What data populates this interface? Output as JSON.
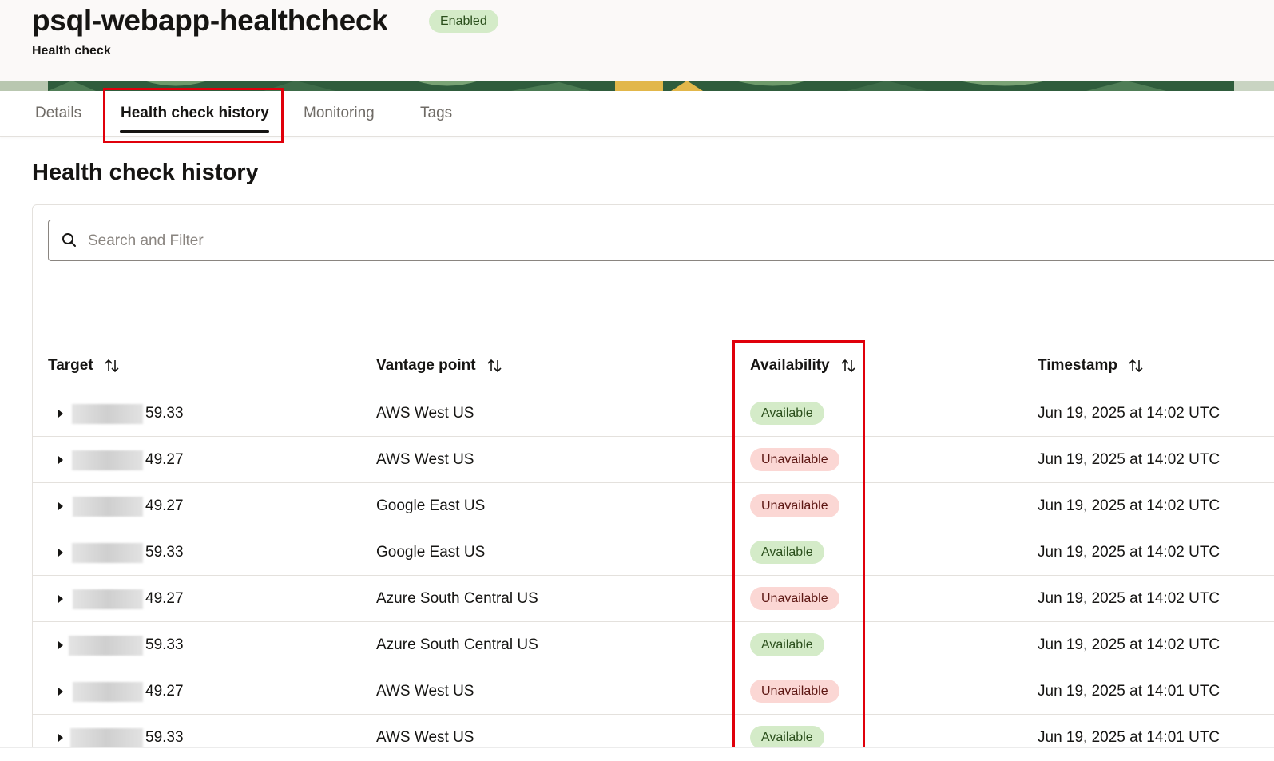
{
  "header": {
    "title": "psql-webapp-healthcheck",
    "status": "Enabled",
    "subtitle": "Health check"
  },
  "tabs": [
    {
      "label": "Details",
      "active": false
    },
    {
      "label": "Health check history",
      "active": true
    },
    {
      "label": "Monitoring",
      "active": false
    },
    {
      "label": "Tags",
      "active": false
    }
  ],
  "section": {
    "title": "Health check history"
  },
  "search": {
    "placeholder": "Search and Filter"
  },
  "table": {
    "columns": [
      "Target",
      "Vantage point",
      "Availability",
      "Timestamp"
    ],
    "rows": [
      {
        "target": "59.33",
        "vantage": "AWS West US",
        "availability": "Available",
        "timestamp": "Jun 19, 2025 at 14:02 UTC"
      },
      {
        "target": "49.27",
        "vantage": "AWS West US",
        "availability": "Unavailable",
        "timestamp": "Jun 19, 2025 at 14:02 UTC"
      },
      {
        "target": "49.27",
        "vantage": "Google East US",
        "availability": "Unavailable",
        "timestamp": "Jun 19, 2025 at 14:02 UTC"
      },
      {
        "target": "59.33",
        "vantage": "Google East US",
        "availability": "Available",
        "timestamp": "Jun 19, 2025 at 14:02 UTC"
      },
      {
        "target": "49.27",
        "vantage": "Azure South Central US",
        "availability": "Unavailable",
        "timestamp": "Jun 19, 2025 at 14:02 UTC"
      },
      {
        "target": "59.33",
        "vantage": "Azure South Central US",
        "availability": "Available",
        "timestamp": "Jun 19, 2025 at 14:02 UTC"
      },
      {
        "target": "49.27",
        "vantage": "AWS West US",
        "availability": "Unavailable",
        "timestamp": "Jun 19, 2025 at 14:01 UTC"
      },
      {
        "target": "59.33",
        "vantage": "AWS West US",
        "availability": "Available",
        "timestamp": "Jun 19, 2025 at 14:01 UTC"
      }
    ]
  },
  "colors": {
    "highlight": "#e0000b",
    "available_bg": "#d4ebc8",
    "unavailable_bg": "#fbd7d4"
  },
  "icons": {
    "search": "search-icon",
    "sort": "sort-icon",
    "expand": "chevron-right-icon"
  }
}
